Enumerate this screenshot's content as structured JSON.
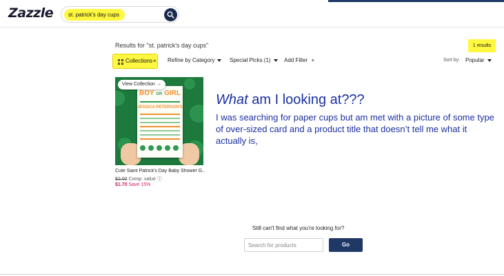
{
  "header": {
    "logo": "Zazzle",
    "search_value": "st. patrick's day cups",
    "search_icon": "magnifier-icon"
  },
  "results": {
    "heading": "Results for \"st. patrick's day cups\"",
    "count": "1 results"
  },
  "filters": {
    "collections": "Collections",
    "collections_remove": "×",
    "refine": "Refine by Category",
    "special_picks": "Special Picks (1)",
    "add_filter": "Add Filter",
    "add_filter_plus": "+",
    "sort_label": "Sort by:",
    "sort_value": "Popular"
  },
  "product": {
    "view_collection": "View Collection →",
    "title": "Cute Saint Patrick's Day Baby Shower G...",
    "original_price": "$2.00",
    "comp_value": "Comp. value ⓘ",
    "sale_price": "$1.70",
    "save": "Save 15%",
    "image": {
      "boy": "BOY",
      "or": "OR",
      "girl": "GIRL",
      "name": "JESSICA PETERSON'S"
    }
  },
  "annotation": {
    "head_em": "What",
    "head_rest": " am I looking at???",
    "body": "I was searching for paper cups but am met with a picture of some type of over-sized card and a product title that doesn’t tell me what it actually is,"
  },
  "bottom": {
    "prompt": "Still can't find what you're looking for?",
    "placeholder": "Search for products",
    "go": "Go"
  },
  "colors": {
    "brand_navy": "#1f3866",
    "highlight_yellow": "#fff740",
    "annotation_blue": "#1a2fa0",
    "sale_pink": "#d6175b"
  }
}
